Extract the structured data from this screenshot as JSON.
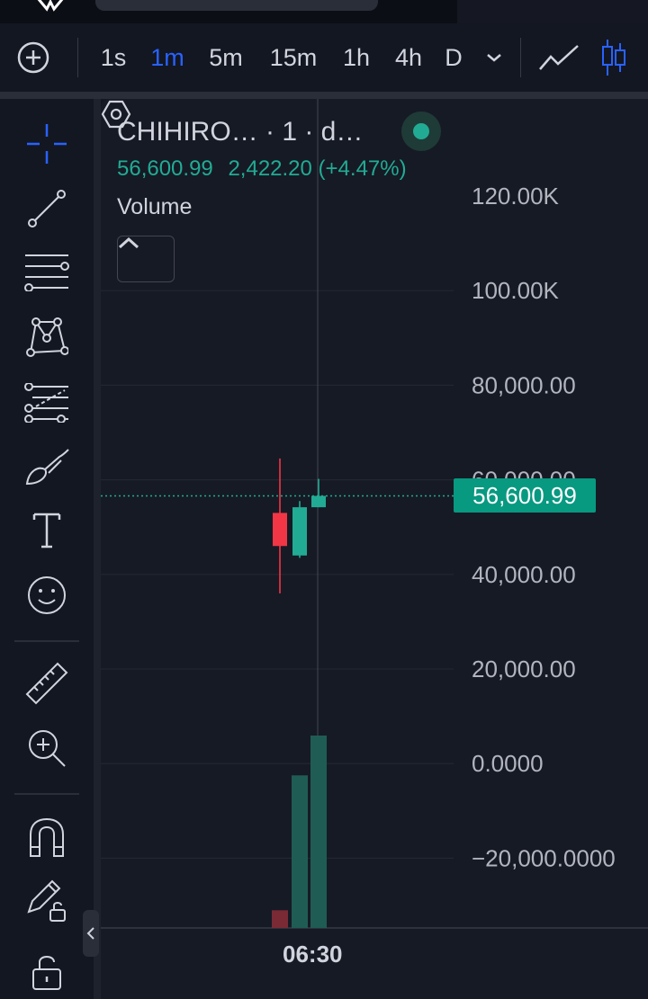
{
  "toolbar": {
    "add_icon": "plus-circle-icon",
    "intervals": [
      {
        "label": "1s",
        "active": false
      },
      {
        "label": "1m",
        "active": true
      },
      {
        "label": "5m",
        "active": false
      },
      {
        "label": "15m",
        "active": false
      },
      {
        "label": "1h",
        "active": false
      },
      {
        "label": "4h",
        "active": false
      },
      {
        "label": "D",
        "active": false
      }
    ],
    "dropdown_icon": "chevron-down-icon",
    "chart_type_icons": [
      "line-chart-icon",
      "candles-icon"
    ]
  },
  "sidebar": {
    "tools": [
      "crosshair-icon",
      "trend-line-icon",
      "fib-retracement-icon",
      "pattern-icon",
      "prediction-icon",
      "brush-icon",
      "text-icon",
      "emoji-icon",
      "ruler-icon",
      "zoom-in-icon",
      "magnet-icon",
      "lock-drawing-icon",
      "unlock-icon"
    ],
    "collapse_icon": "chevron-left-icon"
  },
  "legend": {
    "title": "CHIHIRO… · 1 · d…",
    "last_price": "56,600.99",
    "change": "2,422.20 (+4.47%)",
    "volume_label": "Volume",
    "collapse_icon": "chevron-up-icon"
  },
  "price_axis": {
    "ticks": [
      "120.00K",
      "100.00K",
      "80,000.00",
      "60,000.00",
      "40,000.00",
      "20,000.00",
      "0.0000",
      "−20,000.0000"
    ],
    "current_price_label": "56,600.99"
  },
  "time_axis": {
    "label": "06:30",
    "settings_icon": "settings-hex-icon"
  },
  "colors": {
    "up": "#22ab94",
    "down": "#f23645",
    "accent": "#2962ff",
    "background": "#161a25"
  },
  "chart_data": {
    "type": "candlestick",
    "y_ticks": [
      120000,
      100000,
      80000,
      60000,
      40000,
      20000,
      0,
      -20000
    ],
    "ylim": [
      -33000,
      138000
    ],
    "current_price": 56600.99,
    "candles": [
      {
        "open": 53000,
        "high": 64500,
        "low": 36000,
        "close": 46000,
        "direction": "down"
      },
      {
        "open": 44000,
        "high": 55500,
        "low": 43500,
        "close": 54200,
        "direction": "up"
      },
      {
        "open": 54200,
        "high": 60200,
        "low": 54200,
        "close": 56600.99,
        "direction": "up"
      }
    ],
    "volume": [
      {
        "value": 8,
        "direction": "down"
      },
      {
        "value": 69,
        "direction": "up"
      },
      {
        "value": 87,
        "direction": "up"
      }
    ],
    "x_label": "06:30"
  }
}
